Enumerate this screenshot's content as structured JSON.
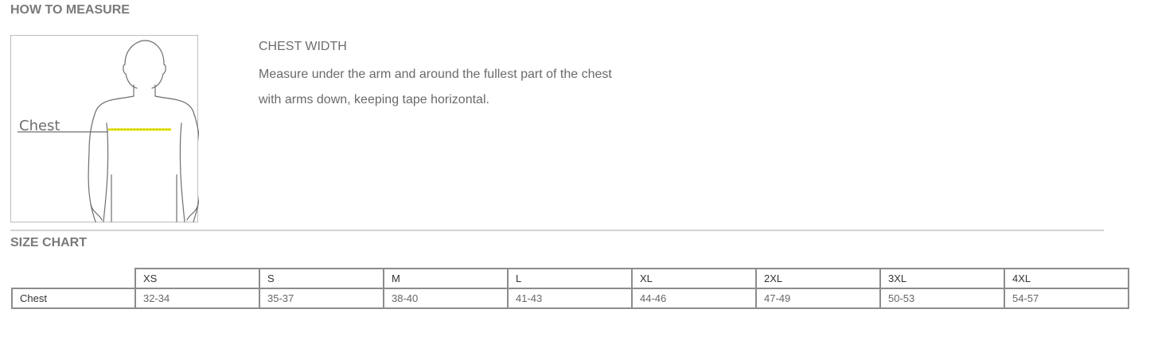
{
  "how_to_measure": {
    "heading": "HOW TO MEASURE",
    "figure_label": "Chest",
    "title": "CHEST WIDTH",
    "description_line1": "Measure under the arm and around the fullest part of the chest",
    "description_line2": "with arms down, keeping tape horizontal."
  },
  "size_chart": {
    "heading": "SIZE CHART",
    "columns": [
      "XS",
      "S",
      "M",
      "L",
      "XL",
      "2XL",
      "3XL",
      "4XL"
    ],
    "rows": [
      {
        "label": "Chest",
        "values": [
          "32-34",
          "35-37",
          "38-40",
          "41-43",
          "44-46",
          "47-49",
          "50-53",
          "54-57"
        ]
      }
    ]
  },
  "colors": {
    "tape": "#e6e600",
    "outline": "#6e6e6e",
    "heading": "#7a7a7a"
  }
}
